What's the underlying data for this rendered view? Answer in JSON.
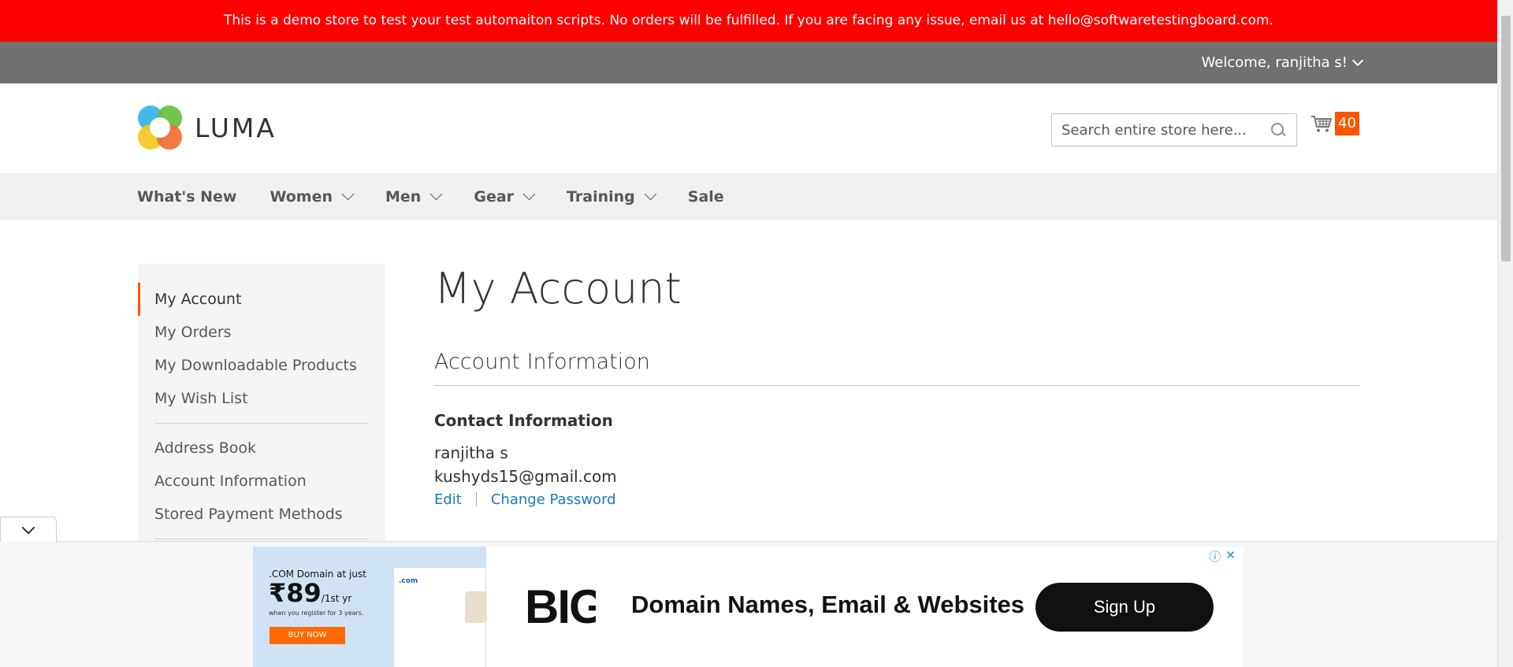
{
  "demo_notice": "This is a demo store to test your test automaiton scripts. No orders will be fulfilled. If you are facing any issue, email us at hello@softwaretestingboard.com.",
  "header": {
    "welcome": "Welcome, ranjitha s!",
    "logo_text": "LUMA",
    "search_placeholder": "Search entire store here...",
    "cart_count": "40"
  },
  "nav": {
    "items": [
      {
        "label": "What's New"
      },
      {
        "label": "Women"
      },
      {
        "label": "Men"
      },
      {
        "label": "Gear"
      },
      {
        "label": "Training"
      },
      {
        "label": "Sale"
      }
    ]
  },
  "sidebar": {
    "items": [
      {
        "label": "My Account"
      },
      {
        "label": "My Orders"
      },
      {
        "label": "My Downloadable Products"
      },
      {
        "label": "My Wish List"
      },
      {
        "label": "Address Book"
      },
      {
        "label": "Account Information"
      },
      {
        "label": "Stored Payment Methods"
      }
    ]
  },
  "main": {
    "page_title": "My Account",
    "section_title": "Account Information",
    "contact_title": "Contact Information",
    "name": "ranjitha s",
    "email": "kushyds15@gmail.com",
    "edit_label": "Edit",
    "change_password_label": "Change Password"
  },
  "ad": {
    "thumb_line1": ".COM Domain at just",
    "thumb_price": "₹89",
    "thumb_price_suffix": "/1st yr",
    "thumb_note": "when you register for 3 years.",
    "thumb_button": "BUY NOW",
    "thumb_domain": ".com",
    "brand_fragment": "BIG",
    "headline": "Domain Names, Email & Websites",
    "cta": "Sign Up"
  },
  "colors": {
    "demo_bar": "#ff0000",
    "accent": "#ff5501",
    "link": "#1979c3",
    "panel": "#6e716e"
  }
}
